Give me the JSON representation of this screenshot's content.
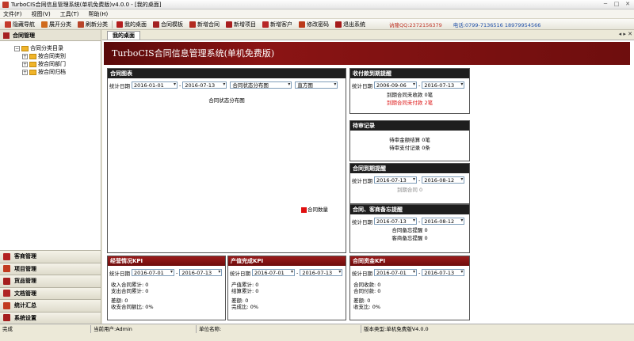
{
  "window": {
    "title": "TurboCIS合同信息管理系统(单机免费版)v4.0.0 - [我的桌面]"
  },
  "menu": [
    "文件(F)",
    "视图(V)",
    "工具(T)",
    "帮助(H)"
  ],
  "toolbar": {
    "buttons": [
      "隐藏导航",
      "展开分类",
      "刷新分类",
      "我的桌面",
      "合同模板",
      "新增合同",
      "新增项目",
      "新增客户",
      "修改密码",
      "退出系统"
    ],
    "qq": "讷隆QQ:2372156379",
    "phone": "电话:0799-7136516 18979954566"
  },
  "sidebar": {
    "header": "合同管理",
    "tree": {
      "root": "合同分类目录",
      "children": [
        "按合同类别",
        "按合同部门",
        "按合同归档"
      ]
    },
    "sections": [
      "客商管理",
      "项目管理",
      "货品管理",
      "文档管理",
      "统计汇总",
      "系统设置"
    ]
  },
  "tab": {
    "label": "我的桌面"
  },
  "banner": {
    "title": "TurboCIS合同信息管理系统(单机免费版)"
  },
  "contract_chart": {
    "title": "合同图表",
    "date_label": "统计日期",
    "date_from": "2016-01-01",
    "date_to": "2016-07-13",
    "chart_select": "合同状态分布图",
    "type_select": "直方图",
    "chart_title": "合同状态分布图",
    "legend": "合同数量"
  },
  "payment_reminder": {
    "title": "收付款到期提醒",
    "date_label": "统计日期",
    "date_from": "2006-09-06",
    "date_to": "2016-07-13",
    "line1": "到期合同未收款 0笔",
    "line2": "到期合同未付款 2笔"
  },
  "pending": {
    "title": "待审记录",
    "line1": "待审金额结算 0笔",
    "line2": "待审支付记录 0条"
  },
  "expiry": {
    "title": "合同到期提醒",
    "date_label": "统计日期",
    "date_from": "2016-07-13",
    "date_to": "2016-08-12",
    "line1": "到期合同 0"
  },
  "memo": {
    "title": "合同、客商备忘提醒",
    "date_label": "统计日期",
    "date_from": "2016-07-13",
    "date_to": "2016-08-12",
    "line1": "合同备忘提醒 0",
    "line2": "客商备忘提醒 0"
  },
  "kpi_ops": {
    "title": "经营情况KPI",
    "date_label": "统计日期",
    "date_from": "2016-07-01",
    "date_to": "2016-07-13",
    "l1": "收入合同累计: 0",
    "l2": "支出合同累计: 0",
    "l3": "差额: 0",
    "l4": "收支合同额比: 0%"
  },
  "kpi_output": {
    "title": "产值完成KPI",
    "date_label": "统计日期",
    "date_from": "2016-07-01",
    "date_to": "2016-07-13",
    "l1": "产值累计: 0",
    "l2": "结算累计: 0",
    "l3": "差额: 0",
    "l4": "完成比: 0%"
  },
  "kpi_funds": {
    "title": "合同资金KPI",
    "date_label": "统计日期",
    "date_from": "2016-07-01",
    "date_to": "2016-07-13",
    "l1": "合同收款: 0",
    "l2": "合同付款: 0",
    "l3": "差额: 0",
    "l4": "收支比: 0%"
  },
  "status": {
    "ready": "完成",
    "user": "当前用户:Admin",
    "unit": "单位名称:",
    "version": "版本类型:单机免费版V4.0.0"
  },
  "colors": {
    "brand_red": "#8b1414",
    "alert_red": "#dd1111"
  }
}
